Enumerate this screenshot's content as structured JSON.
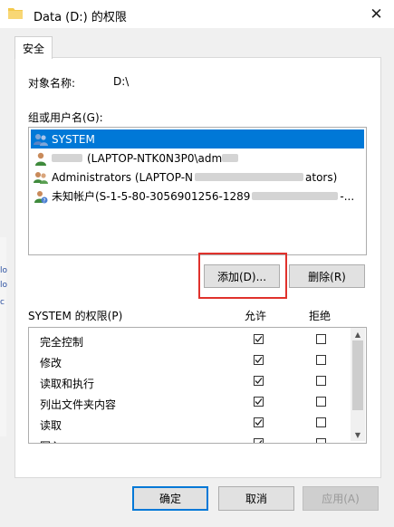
{
  "window": {
    "title": "Data (D:) 的权限"
  },
  "tabs": [
    {
      "label": "安全"
    }
  ],
  "object": {
    "label": "对象名称:",
    "value": "D:\\"
  },
  "groups": {
    "label": "组或用户名(G):",
    "items": [
      {
        "name": "SYSTEM",
        "selected": true
      },
      {
        "prefix": "",
        "name": "(LAPTOP-NTK0N3P0\\adm"
      },
      {
        "name": "Administrators (LAPTOP-N",
        "suffix": "ators)"
      },
      {
        "name": "未知帐户(S-1-5-80-3056901256-1289",
        "suffix": "-..."
      }
    ]
  },
  "buttons": {
    "add": "添加(D)...",
    "remove": "删除(R)",
    "ok": "确定",
    "cancel": "取消",
    "apply": "应用(A)"
  },
  "permissions": {
    "label": "SYSTEM 的权限(P)",
    "allow_header": "允许",
    "deny_header": "拒绝",
    "rows": [
      {
        "name": "完全控制",
        "allow": true,
        "deny": false
      },
      {
        "name": "修改",
        "allow": true,
        "deny": false
      },
      {
        "name": "读取和执行",
        "allow": true,
        "deny": false
      },
      {
        "name": "列出文件夹内容",
        "allow": true,
        "deny": false
      },
      {
        "name": "读取",
        "allow": true,
        "deny": false
      },
      {
        "name": "写入",
        "allow": true,
        "deny": false
      }
    ]
  },
  "background_window": {
    "left_letters": [
      "lo",
      "lo",
      "c"
    ]
  }
}
